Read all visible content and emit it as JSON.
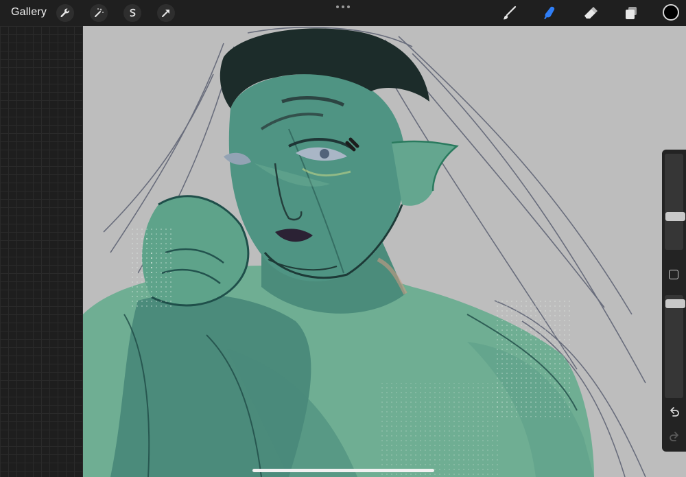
{
  "toolbar": {
    "gallery_label": "Gallery",
    "left_tools": [
      "wrench-icon",
      "magic-wand-icon",
      "selection-icon",
      "transform-arrow-icon"
    ],
    "right_tools": [
      "brush-icon",
      "smudge-icon",
      "eraser-icon",
      "layers-icon"
    ],
    "active_tool": "smudge-icon",
    "active_color": "#000000",
    "accent": "#2f7ef6"
  },
  "canvas": {
    "background": "#bdbdbd",
    "skin_color": "#6fae93",
    "hair_color": "#1c2c2a",
    "sketch_color": "#4a4f63"
  },
  "sidebar": {
    "size_slider_level": 0.35,
    "opacity_slider_level": 0.02,
    "controls": [
      "modify-square-icon",
      "undo-icon",
      "redo-icon"
    ]
  }
}
